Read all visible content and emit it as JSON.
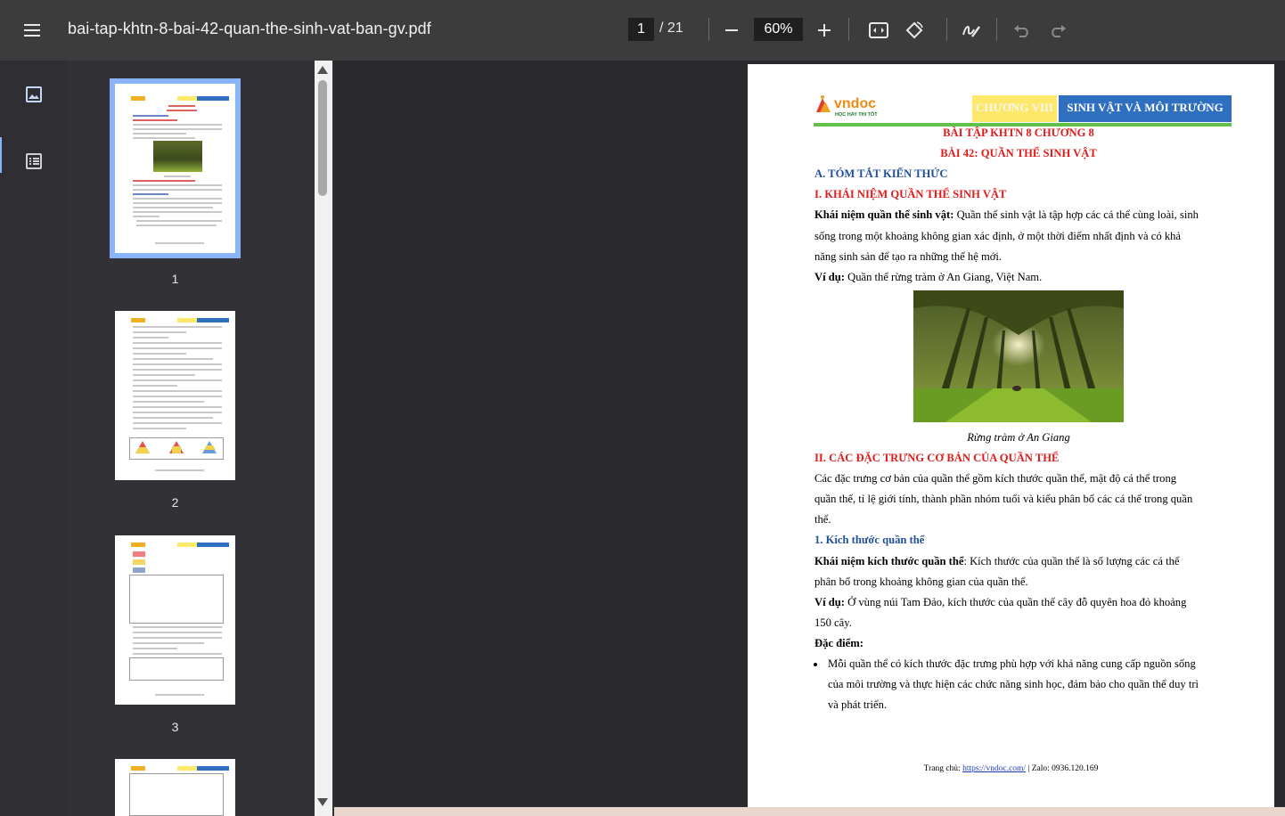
{
  "toolbar": {
    "filename": "bai-tap-khtn-8-bai-42-quan-the-sinh-vat-ban-gv.pdf",
    "current_page": "1",
    "total_pages": "/ 21",
    "zoom": "60%",
    "icons": [
      "menu-icon",
      "zoom-out-icon",
      "zoom-in-icon",
      "fit-page-icon",
      "rotate-icon",
      "annotate-icon",
      "undo-icon",
      "redo-icon"
    ]
  },
  "rail": {
    "icons": [
      "thumbnails-icon",
      "outline-icon"
    ]
  },
  "thumbnails": [
    {
      "label": "1",
      "selected": true
    },
    {
      "label": "2",
      "selected": false
    },
    {
      "label": "3",
      "selected": false
    }
  ],
  "document": {
    "logo_brand": "vndoc",
    "logo_tagline": "HỌC HAY THI TỐT",
    "header_chapter": "CHƯƠNG VIII",
    "header_topic": "SINH VẬT VÀ MÔI TRƯỜNG",
    "title1": "BÀI TẬP KHTN 8 CHƯƠNG 8",
    "title2": "BÀI 42: QUẦN THỂ SINH VẬT",
    "section_a": "A. TÓM TẮT KIẾN THỨC",
    "section_1": "I. KHÁI NIỆM QUẦN THỂ SINH VẬT",
    "def_label": "Khái niệm quần thể sinh vật:",
    "def_line1": " Quần thể sinh vật là tập hợp các cá thể cùng loài, sinh",
    "def_line2": "sống trong một khoảng không gian xác định, ở một thời điểm nhất định và có khả",
    "def_line3": "năng sinh sản để tạo ra những thế hệ mới.",
    "example_label": "Ví dụ:",
    "example_text": " Quần thể rừng tràm ở An Giang, Việt Nam.",
    "caption": "Rừng tràm ở An Giang",
    "section_2": "II. CÁC ĐẶC TRƯNG CƠ BẢN CỦA QUẦN THỂ",
    "s2_line1": "Các đặc trưng cơ bản của quần thể gồm kích thước quần thể, mật độ cá thể trong",
    "s2_line2": "quần thể, tỉ lệ giới tính, thành phần nhóm tuổi và kiểu phân bố các cá thể trong quần",
    "s2_line3": "thể.",
    "sub_1": "1. Kích thước quần thể",
    "size_label": "Khái niệm kích thước quần thể",
    "size_line1": ": Kích thước của quần thể là số lượng các cá thể",
    "size_line2": "phân bố trong khoảng không gian của quần thể.",
    "ex2_label": "Ví dụ:",
    "ex2_line1": " Ở vùng núi Tam Đảo, kích thước của quần thể cây đỗ quyên hoa đỏ khoảng",
    "ex2_line2": "150 cây.",
    "features_label": "Đặc điểm:",
    "bullet_line1": "Mỗi quần thể có kích thước đặc trưng phù hợp với khả năng cung cấp nguồn sống",
    "bullet_line2": "của môi trường và thực hiện các chức năng sinh học, đảm bảo cho quần thể duy trì",
    "bullet_line3": "và phát triển.",
    "footer_prefix": "Trang chủ: ",
    "footer_link": "https://vndoc.com/",
    "footer_suffix": " | Zalo: 0936.120.169"
  },
  "colors": {
    "toolbar": "#3c3c3c",
    "accent": "#8ab4f8",
    "heading_red": "#e01b1b",
    "heading_blue": "#1f4e9a",
    "header_blue": "#2f6fbf",
    "header_yellow": "#fde86a",
    "header_line": "#62c04a"
  }
}
